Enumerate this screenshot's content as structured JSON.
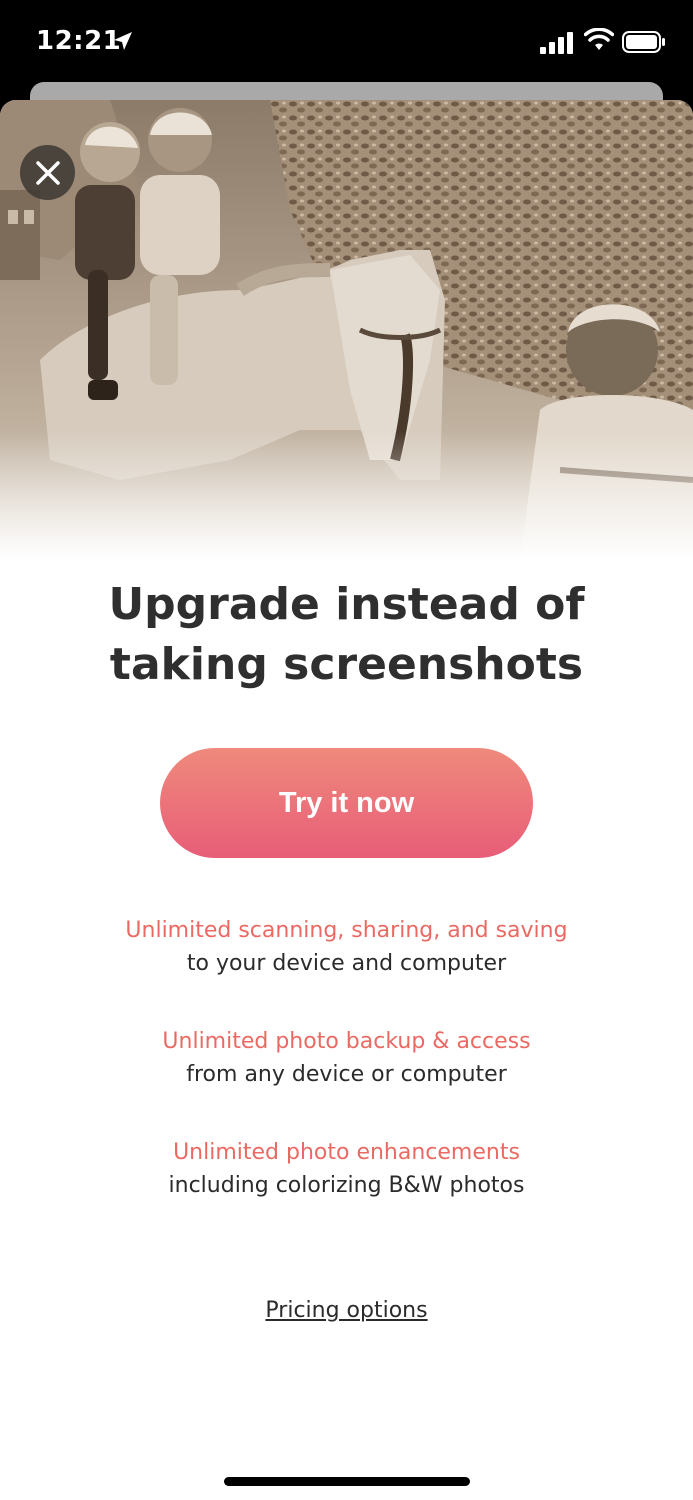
{
  "status_bar": {
    "time": "12:21",
    "icons": [
      "location-arrow-icon",
      "cellular-signal-icon",
      "wifi-icon",
      "battery-icon"
    ]
  },
  "hero": {
    "description_icon": "sepia-photo-horse-children"
  },
  "close": {
    "icon": "close-icon"
  },
  "headline": {
    "line1": "Upgrade instead of",
    "line2": "taking screenshots"
  },
  "cta": {
    "label": "Try it now"
  },
  "features": [
    {
      "title": "Unlimited scanning, sharing, and saving",
      "subtitle": "to your device and computer"
    },
    {
      "title": "Unlimited photo backup & access",
      "subtitle": "from any device or computer"
    },
    {
      "title": "Unlimited photo enhancements",
      "subtitle": "including colorizing B&W photos"
    }
  ],
  "pricing": {
    "label": "Pricing options"
  },
  "colors": {
    "accent": "#ea6a63",
    "button_top": "#ef8a7c",
    "button_bottom": "#e85d78",
    "text_dark": "#2f2f2f"
  }
}
